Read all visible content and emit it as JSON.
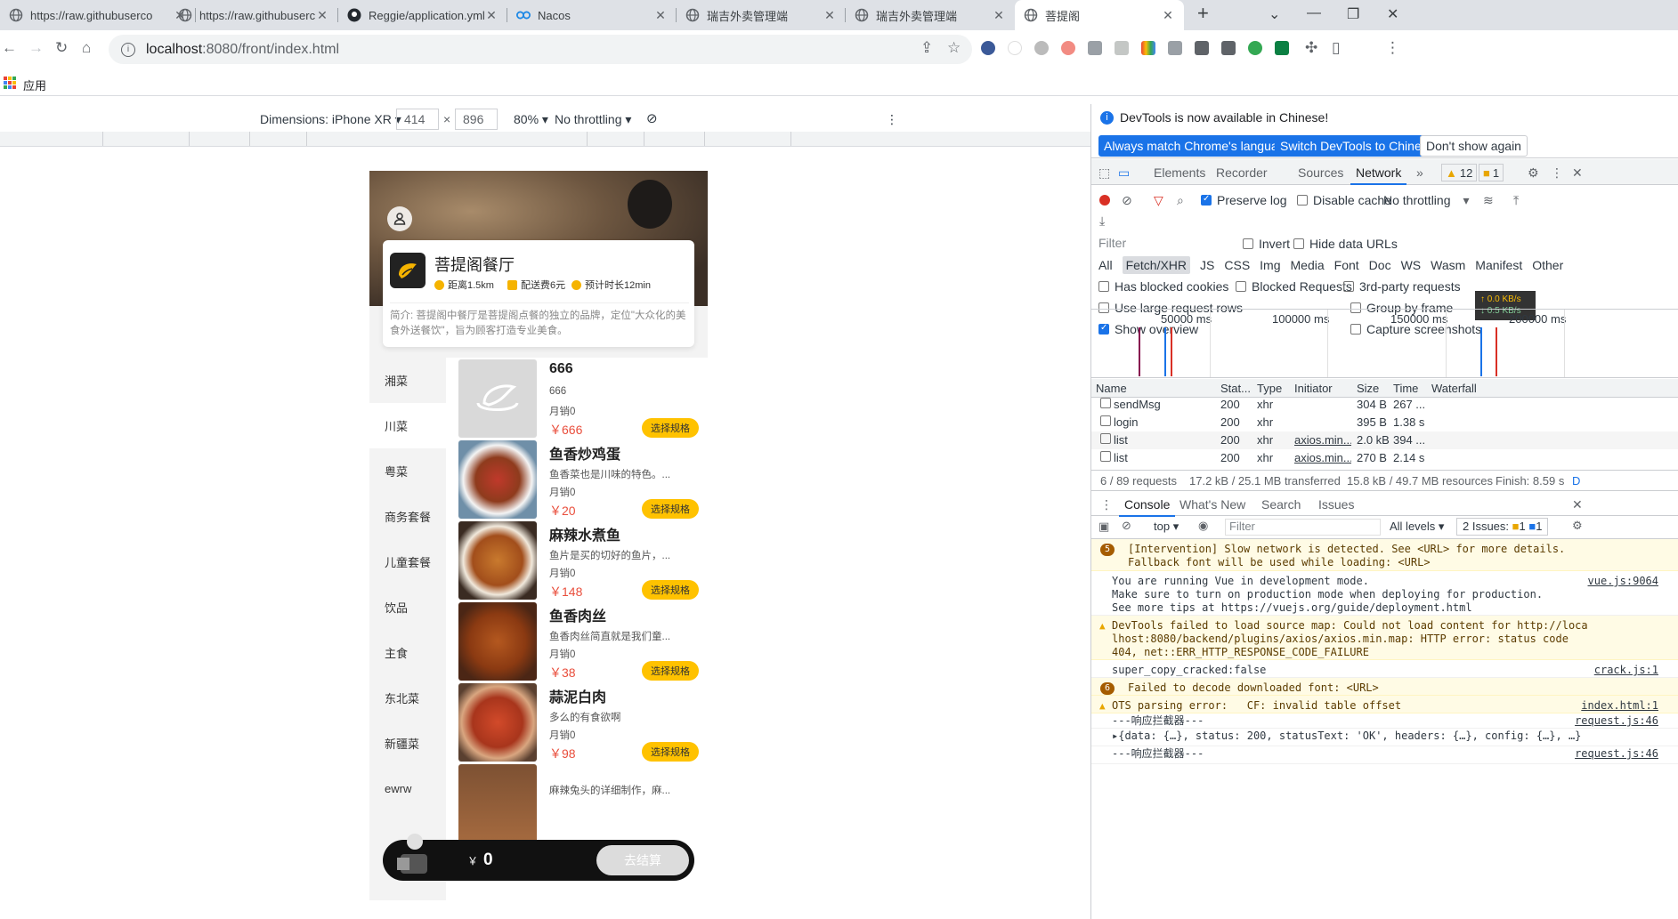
{
  "browser": {
    "tabs": [
      {
        "title": "https://raw.githubuserco",
        "icon": "globe-icon"
      },
      {
        "title": "https://raw.githubuserco",
        "icon": "globe-icon"
      },
      {
        "title": "Reggie/application.yml at",
        "icon": "github-icon"
      },
      {
        "title": "Nacos",
        "icon": "nacos-icon"
      },
      {
        "title": "瑞吉外卖管理端",
        "icon": "globe-icon"
      },
      {
        "title": "瑞吉外卖管理端",
        "icon": "globe-icon"
      },
      {
        "title": "菩提阁",
        "icon": "globe-icon",
        "active": true
      }
    ],
    "url_host": "localhost",
    "url_path": ":8080/front/index.html",
    "bookmarks_label": "应用"
  },
  "device_toolbar": {
    "dimensions_label": "Dimensions: iPhone XR",
    "width": "414",
    "x": "×",
    "height": "896",
    "zoom": "80%",
    "throttle": "No throttling"
  },
  "app": {
    "shop_name": "菩提阁餐厅",
    "distance": "距离1.5km",
    "delivery_fee": "配送费6元",
    "eta": "预计时长12min",
    "description": "简介: 菩提阁中餐厅是菩提阁点餐的独立的品牌，定位\"大众化的美食外送餐饮\"，旨为顾客打造专业美食。",
    "categories": [
      "湘菜",
      "川菜",
      "粤菜",
      "商务套餐",
      "儿童套餐",
      "饮品",
      "主食",
      "东北菜",
      "新疆菜",
      "ewrw"
    ],
    "active_category": "川菜",
    "dishes": [
      {
        "name": "666",
        "desc": "666",
        "sales": "月销0",
        "price": "￥666",
        "spec": "选择规格",
        "placeholder": true
      },
      {
        "name": "鱼香炒鸡蛋",
        "desc": "鱼香菜也是川味的特色。...",
        "sales": "月销0",
        "price": "￥20",
        "spec": "选择规格"
      },
      {
        "name": "麻辣水煮鱼",
        "desc": "鱼片是买的切好的鱼片，...",
        "sales": "月销0",
        "price": "￥148",
        "spec": "选择规格"
      },
      {
        "name": "鱼香肉丝",
        "desc": "鱼香肉丝简直就是我们童...",
        "sales": "月销0",
        "price": "￥38",
        "spec": "选择规格"
      },
      {
        "name": "蒜泥白肉",
        "desc": "多么的有食欲啊",
        "sales": "月销0",
        "price": "￥98",
        "spec": "选择规格"
      },
      {
        "name": "",
        "desc": "麻辣兔头的详细制作，麻...",
        "sales": "",
        "price": "",
        "spec": ""
      }
    ],
    "cart_total_symbol": "￥",
    "cart_total": "0",
    "checkout_label": "去结算"
  },
  "devtools": {
    "infobar_text": "DevTools is now available in Chinese!",
    "btn_match": "Always match Chrome's language",
    "btn_switch": "Switch DevTools to Chinese",
    "btn_dont": "Don't show again",
    "tabs": [
      "Elements",
      "Recorder",
      "Sources",
      "Network"
    ],
    "active_tab": "Network",
    "warn_count": "12",
    "issue_count": "1",
    "preserve_log": "Preserve log",
    "disable_cache": "Disable cache",
    "throttling": "No throttling",
    "filter_placeholder": "Filter",
    "invert": "Invert",
    "hide_data_urls": "Hide data URLs",
    "types": [
      "All",
      "Fetch/XHR",
      "JS",
      "CSS",
      "Img",
      "Media",
      "Font",
      "Doc",
      "WS",
      "Wasm",
      "Manifest",
      "Other"
    ],
    "selected_type": "Fetch/XHR",
    "has_blocked_cookies": "Has blocked cookies",
    "blocked_requests": "Blocked Requests",
    "third_party": "3rd-party requests",
    "large_rows": "Use large request rows",
    "group_by_frame": "Group by frame",
    "show_overview": "Show overview",
    "capture_screenshots": "Capture screenshots",
    "speed_up": "↑ 0.0 KB/s",
    "speed_down": "↓ 0.5 KB/s",
    "overview_ticks": [
      "50000 ms",
      "100000 ms",
      "150000 ms",
      "200000 ms"
    ],
    "columns": [
      "Name",
      "Stat...",
      "Type",
      "Initiator",
      "Size",
      "Time",
      "Waterfall"
    ],
    "requests": [
      {
        "name": "sendMsg",
        "status": "200",
        "type": "xhr",
        "initiator": "",
        "size": "304 B",
        "time": "267 ..."
      },
      {
        "name": "login",
        "status": "200",
        "type": "xhr",
        "initiator": "",
        "size": "395 B",
        "time": "1.38 s"
      },
      {
        "name": "list",
        "status": "200",
        "type": "xhr",
        "initiator": "axios.min....",
        "size": "2.0 kB",
        "time": "394 ..."
      },
      {
        "name": "list",
        "status": "200",
        "type": "xhr",
        "initiator": "axios.min....",
        "size": "270 B",
        "time": "2.14 s"
      }
    ],
    "summary": {
      "requests": "6 / 89 requests",
      "transferred": "17.2 kB / 25.1 MB transferred",
      "resources": "15.8 kB / 49.7 MB resources",
      "finish": "Finish: 8.59 s",
      "more": "D"
    },
    "drawer_tabs": [
      "Console",
      "What's New",
      "Search",
      "Issues"
    ],
    "console_context": "top",
    "console_filter": "Filter",
    "log_levels": "All levels",
    "issues_label": "2 Issues:",
    "issues_warn": "1",
    "issues_info": "1",
    "messages": [
      {
        "kind": "warn-count",
        "count": "5",
        "text": "[Intervention] Slow network is detected. See <URL> for more details.\nFallback font will be used while loading: <URL>",
        "src": ""
      },
      {
        "kind": "log",
        "text": "You are running Vue in development mode.\nMake sure to turn on production mode when deploying for production.\nSee more tips at https://vuejs.org/guide/deployment.html",
        "src": "vue.js:9064"
      },
      {
        "kind": "warn",
        "text": "DevTools failed to load source map: Could not load content for http://loca\nlhost:8080/backend/plugins/axios/axios.min.map: HTTP error: status code\n404, net::ERR_HTTP_RESPONSE_CODE_FAILURE",
        "src": ""
      },
      {
        "kind": "log",
        "text": "super_copy_cracked:false",
        "src": "crack.js:1"
      },
      {
        "kind": "warn-count",
        "count": "6",
        "text": "Failed to decode downloaded font: <URL>",
        "src": ""
      },
      {
        "kind": "warn",
        "text": "OTS parsing error:   CF: invalid table offset",
        "src": "index.html:1"
      },
      {
        "kind": "log",
        "text": "---响应拦截器---",
        "src": "request.js:46"
      },
      {
        "kind": "log",
        "text": "▸{data: {…}, status: 200, statusText: 'OK', headers: {…}, config: {…}, …}",
        "src": ""
      },
      {
        "kind": "log",
        "text": "---响应拦截器---",
        "src": "request.js:46"
      }
    ]
  }
}
